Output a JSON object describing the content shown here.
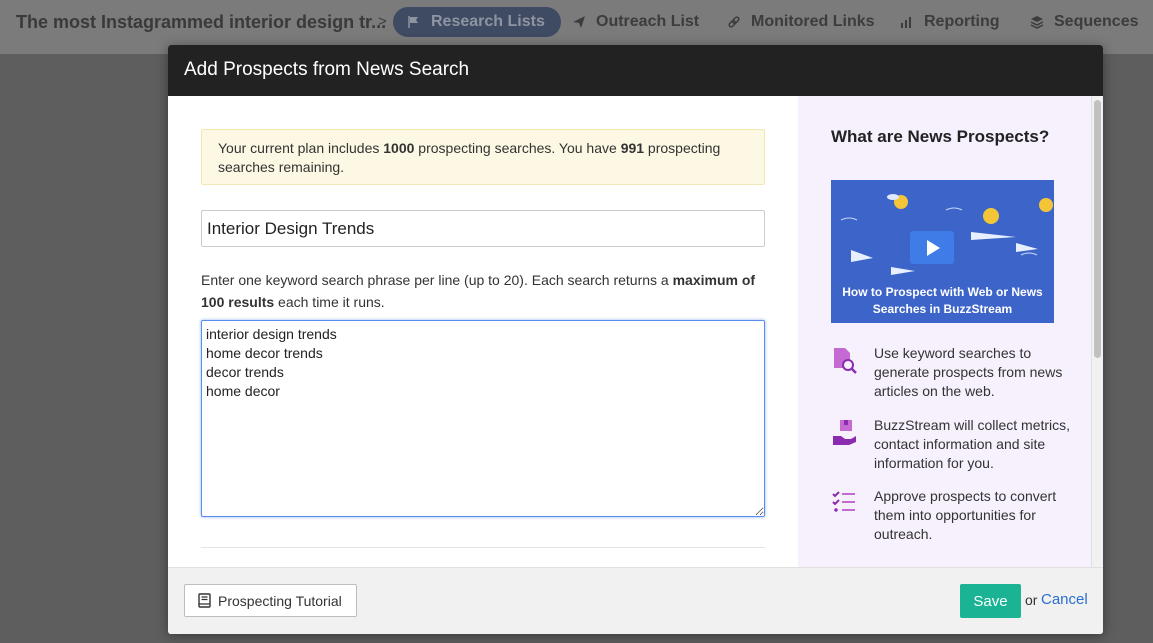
{
  "nav": {
    "project_title": "The most Instagrammed interior design tr...",
    "separator": ">",
    "tabs": [
      {
        "label": "Research Lists",
        "active": true,
        "icon": "flag-icon"
      },
      {
        "label": "Outreach List",
        "active": false,
        "icon": "paper-plane-icon"
      },
      {
        "label": "Monitored Links",
        "active": false,
        "icon": "link-icon"
      },
      {
        "label": "Reporting",
        "active": false,
        "icon": "bar-chart-icon"
      },
      {
        "label": "Sequences",
        "active": false,
        "icon": "layers-icon"
      }
    ]
  },
  "modal": {
    "title": "Add Prospects from News Search",
    "notice": {
      "pre": "Your current plan includes ",
      "plan_total": "1000",
      "mid": " prospecting searches. You have ",
      "remaining": "991",
      "post": " prospecting searches remaining."
    },
    "name_value": "Interior Design Trends",
    "help": {
      "pre": "Enter one keyword search phrase per line (up to 20). Each search returns a ",
      "bold": "maximum of 100 results",
      "post": " each time it runs."
    },
    "keywords_value": "interior design trends\nhome decor trends\ndecor trends\nhome decor"
  },
  "side": {
    "title": "What are News Prospects?",
    "video_caption": "How to Prospect with Web or News Searches in BuzzStream",
    "features": [
      {
        "icon": "search-document-icon",
        "text": "Use keyword searches to generate prospects from news articles on the web."
      },
      {
        "icon": "box-hand-icon",
        "text": "BuzzStream will collect metrics, contact information and site information for you."
      },
      {
        "icon": "checklist-icon",
        "text": "Approve prospects to convert them into opportunities for outreach."
      }
    ]
  },
  "footer": {
    "tutorial_label": "Prospecting Tutorial",
    "save_label": "Save",
    "or_text": "or",
    "cancel_label": "Cancel"
  },
  "colors": {
    "header_bg": "#222222",
    "accent_save": "#1ab394",
    "link": "#2a6fd0",
    "icon_purple": "#b23cc4",
    "side_bg": "#f6f1fd",
    "notice_bg": "#fcf8e3"
  }
}
